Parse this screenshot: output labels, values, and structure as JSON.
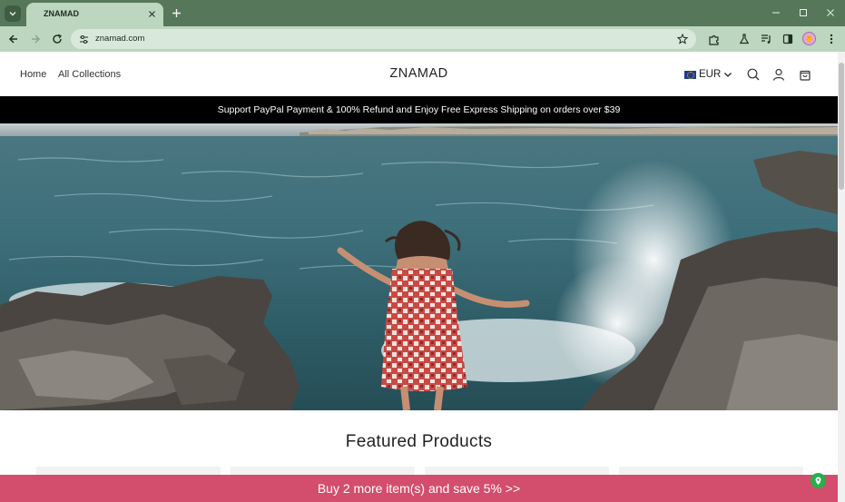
{
  "browser": {
    "tab": {
      "title": "ZNAMAD"
    },
    "omnibox": {
      "url": "znamad.com"
    }
  },
  "site": {
    "nav": [
      {
        "label": "Home"
      },
      {
        "label": "All Collections"
      }
    ],
    "logo": "ZNAMAD",
    "currency": {
      "code": "EUR"
    },
    "announcement": "Support PayPal Payment & 100% Refund and Enjoy Free Express Shipping on orders over $39",
    "featured_title": "Featured Products",
    "promo": "Buy 2 more item(s) and save 5%  >>"
  },
  "colors": {
    "chrome_frame": "#56775a",
    "chrome_toolbar": "#bcd6bf",
    "announcement_bg": "#000000",
    "promo_bg": "#d34e6c",
    "chat_badge": "#25b04a"
  }
}
